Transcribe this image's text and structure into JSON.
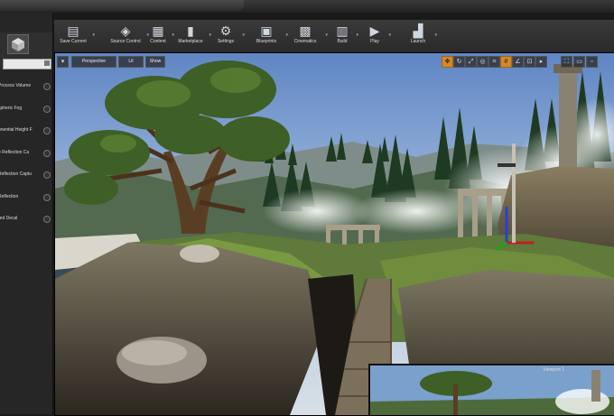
{
  "toolbar": {
    "buttons": [
      {
        "label": "Save Current",
        "icon": "save-icon",
        "glyph": "▤"
      },
      {
        "label": "Source Control",
        "icon": "source-control-icon",
        "glyph": "◈"
      },
      {
        "label": "Content",
        "icon": "content-icon",
        "glyph": "▦"
      },
      {
        "label": "Marketplace",
        "icon": "marketplace-icon",
        "glyph": "▮"
      },
      {
        "label": "Settings",
        "icon": "settings-icon",
        "glyph": "⚙"
      },
      {
        "label": "Blueprints",
        "icon": "blueprints-icon",
        "glyph": "▣"
      },
      {
        "label": "Cinematics",
        "icon": "cinematics-icon",
        "glyph": "▩"
      },
      {
        "label": "Build",
        "icon": "build-icon",
        "glyph": "▥"
      },
      {
        "label": "Play",
        "icon": "play-icon",
        "glyph": "▶"
      },
      {
        "label": "Launch",
        "icon": "launch-icon",
        "glyph": "▟"
      }
    ]
  },
  "left_panel": {
    "items": [
      "Process Volume",
      "spheric Fog",
      "onential Height F",
      "e Reflection Ca",
      "Reflection Captu",
      "Reflection",
      "red Decal"
    ]
  },
  "viewport": {
    "view_mode": "Perspective",
    "lit_mode": "Lit",
    "show_label": "Show",
    "pip_label": "Viewport 1"
  },
  "colors": {
    "accent": "#d2882b",
    "panel_bg": "#262626",
    "toolbar_bg": "#2f2f2f"
  }
}
